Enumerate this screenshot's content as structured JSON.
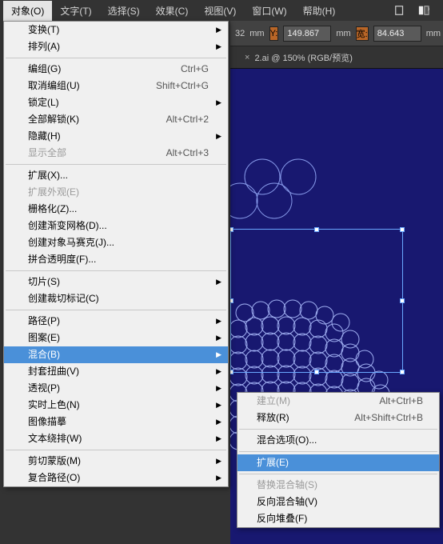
{
  "menubar": {
    "items": [
      "对象(O)",
      "文字(T)",
      "选择(S)",
      "效果(C)",
      "视图(V)",
      "窗口(W)",
      "帮助(H)"
    ]
  },
  "toolbar": {
    "unit_suffix": "mm",
    "value_y_prefix": "32",
    "y_label": "Y:",
    "y_value": "149.867",
    "w_label": "宽:",
    "w_value": "84.643",
    "unit2": "mm"
  },
  "tab": {
    "label": "2.ai @ 150% (RGB/预览)",
    "close": "×"
  },
  "dropdown": {
    "transform": "变换(T)",
    "arrange": "排列(A)",
    "group": "编组(G)",
    "group_sc": "Ctrl+G",
    "ungroup": "取消编组(U)",
    "ungroup_sc": "Shift+Ctrl+G",
    "lock": "锁定(L)",
    "unlock_all": "全部解锁(K)",
    "unlock_all_sc": "Alt+Ctrl+2",
    "hide": "隐藏(H)",
    "show_all": "显示全部",
    "show_all_sc": "Alt+Ctrl+3",
    "expand": "扩展(X)...",
    "expand_appearance": "扩展外观(E)",
    "rasterize": "栅格化(Z)...",
    "gradient_mesh": "创建渐变网格(D)...",
    "mosaic": "创建对象马赛克(J)...",
    "flatten": "拼合透明度(F)...",
    "slice": "切片(S)",
    "crop_marks": "创建裁切标记(C)",
    "path": "路径(P)",
    "pattern": "图案(E)",
    "blend": "混合(B)",
    "envelope": "封套扭曲(V)",
    "perspective": "透视(P)",
    "live_paint": "实时上色(N)",
    "image_trace": "图像描摹",
    "text_wrap": "文本绕排(W)",
    "clipping_mask": "剪切蒙版(M)",
    "compound_path": "复合路径(O)"
  },
  "submenu": {
    "make": "建立(M)",
    "make_sc": "Alt+Ctrl+B",
    "release": "释放(R)",
    "release_sc": "Alt+Shift+Ctrl+B",
    "blend_options": "混合选项(O)...",
    "expand": "扩展(E)",
    "replace_spine": "替换混合轴(S)",
    "reverse_spine": "反向混合轴(V)",
    "reverse_front": "反向堆叠(F)"
  }
}
